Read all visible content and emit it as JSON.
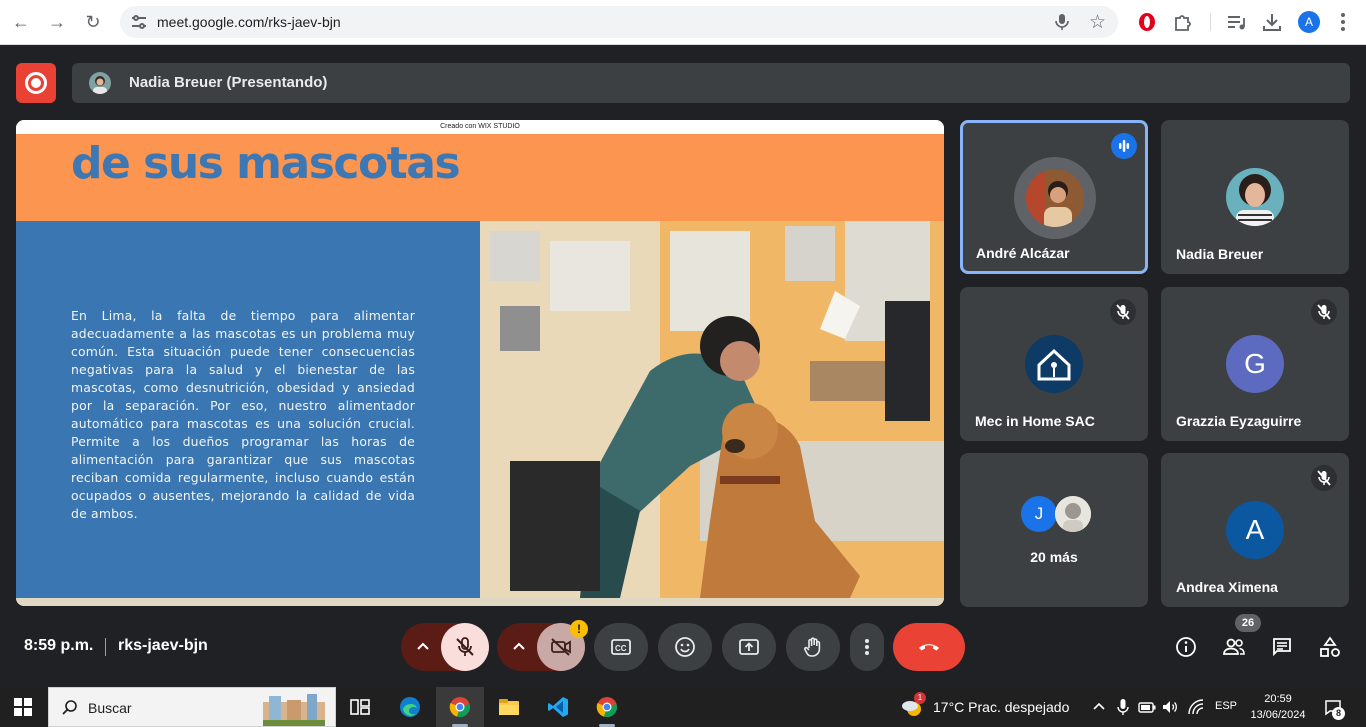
{
  "browser": {
    "url": "meet.google.com/rks-jaev-bjn",
    "profile_initial": "A"
  },
  "meet": {
    "presenter_label": "Nadia Breuer (Presentando)",
    "slide": {
      "watermark": "Creado con WIX STUDIO",
      "heading": "de sus mascotas",
      "paragraph": "En Lima, la falta de tiempo para alimentar adecuadamente a las mascotas es un problema muy común. Esta situación puede tener consecuencias negativas para la salud y el bienestar de las mascotas, como desnutrición, obesidad y ansiedad por la separación. Por eso, nuestro alimentador automático para mascotas es una solución crucial. Permite a los dueños programar las horas de alimentación para garantizar que sus mascotas reciban comida regularmente, incluso cuando están ocupados o ausentes, mejorando la calidad de vida de ambos."
    },
    "participants": [
      {
        "name": "André Alcázar",
        "state": "speaking"
      },
      {
        "name": "Nadia Breuer",
        "state": "unmuted"
      },
      {
        "name": "Mec in Home SAC",
        "state": "muted"
      },
      {
        "name": "Grazzia Eyzaguirre",
        "state": "muted",
        "initial": "G",
        "color": "#5c6bc0"
      },
      {
        "name": "20 más",
        "state": "group",
        "initial": "J",
        "color": "#1a73e8"
      },
      {
        "name": "Andrea Ximena",
        "state": "muted",
        "initial": "A",
        "color": "#0b57a0"
      }
    ],
    "footer": {
      "time": "8:59 p.m.",
      "meeting_code": "rks-jaev-bjn",
      "camera_warning": "!",
      "people_count": "26"
    },
    "colors": {
      "accent": "#8ab4f8",
      "hangup": "#ea4335",
      "mic_off_bg": "#f9dedc"
    }
  },
  "taskbar": {
    "search_placeholder": "Buscar",
    "weather": "17°C  Prac. despejado",
    "weather_badge": "1",
    "lang": "ESP",
    "time": "20:59",
    "date": "13/06/2024",
    "notification_count": "8"
  }
}
